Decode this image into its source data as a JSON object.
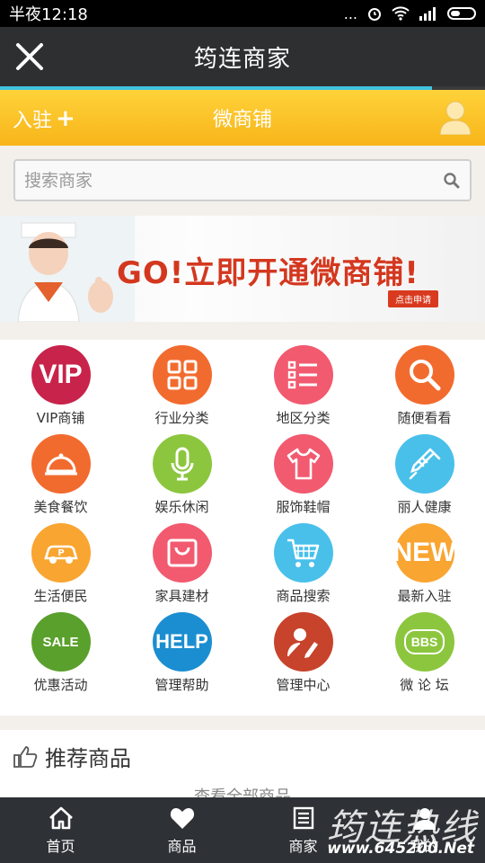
{
  "status": {
    "time": "半夜12:18",
    "dots": "..."
  },
  "header": {
    "title": "筠连商家",
    "progress": 0.89
  },
  "shopbar": {
    "join_label": "入驻",
    "plus": "+",
    "title": "微商铺"
  },
  "search": {
    "placeholder": "搜索商家"
  },
  "banner": {
    "slogan": "GO!立即开通微商铺!",
    "apply": "点击申请"
  },
  "categories": [
    {
      "label": "VIP商铺",
      "icon": "vip-icon",
      "color": "#c8234a",
      "text": "VIP"
    },
    {
      "label": "行业分类",
      "icon": "grid-icon",
      "color": "#f26b2e"
    },
    {
      "label": "地区分类",
      "icon": "list-icon",
      "color": "#f25a6f"
    },
    {
      "label": "随便看看",
      "icon": "magnifier-icon",
      "color": "#f26b2e"
    },
    {
      "label": "美食餐饮",
      "icon": "food-cover-icon",
      "color": "#f26b2e"
    },
    {
      "label": "娱乐休闲",
      "icon": "microphone-icon",
      "color": "#8cc63e"
    },
    {
      "label": "服饰鞋帽",
      "icon": "tshirt-icon",
      "color": "#f25a6f"
    },
    {
      "label": "丽人健康",
      "icon": "syringe-icon",
      "color": "#49c0ea"
    },
    {
      "label": "生活便民",
      "icon": "parking-car-icon",
      "color": "#f9a531"
    },
    {
      "label": "家具建材",
      "icon": "bag-icon",
      "color": "#f25a6f"
    },
    {
      "label": "商品搜索",
      "icon": "cart-icon",
      "color": "#49c0ea"
    },
    {
      "label": "最新入驻",
      "icon": "new-icon",
      "color": "#f9a531",
      "text": "NEW"
    },
    {
      "label": "优惠活动",
      "icon": "sale-icon",
      "color": "#5aa02c",
      "text": "SALE"
    },
    {
      "label": "管理帮助",
      "icon": "help-icon",
      "color": "#1b8ed1",
      "text": "HELP"
    },
    {
      "label": "管理中心",
      "icon": "manager-icon",
      "color": "#c7432b"
    },
    {
      "label": "微 论 坛",
      "icon": "bbs-icon",
      "color": "#8cc63e",
      "text": "BBS"
    }
  ],
  "recommend": {
    "title": "推荐商品",
    "more": "查看全部商品"
  },
  "tabs": [
    {
      "label": "首页",
      "icon": "home-icon"
    },
    {
      "label": "商品",
      "icon": "heart-icon"
    },
    {
      "label": "商家",
      "icon": "store-icon"
    },
    {
      "label": "我的",
      "icon": "user-icon"
    }
  ],
  "watermark": {
    "text": "筠连热线",
    "url": "www.645200.Net"
  }
}
